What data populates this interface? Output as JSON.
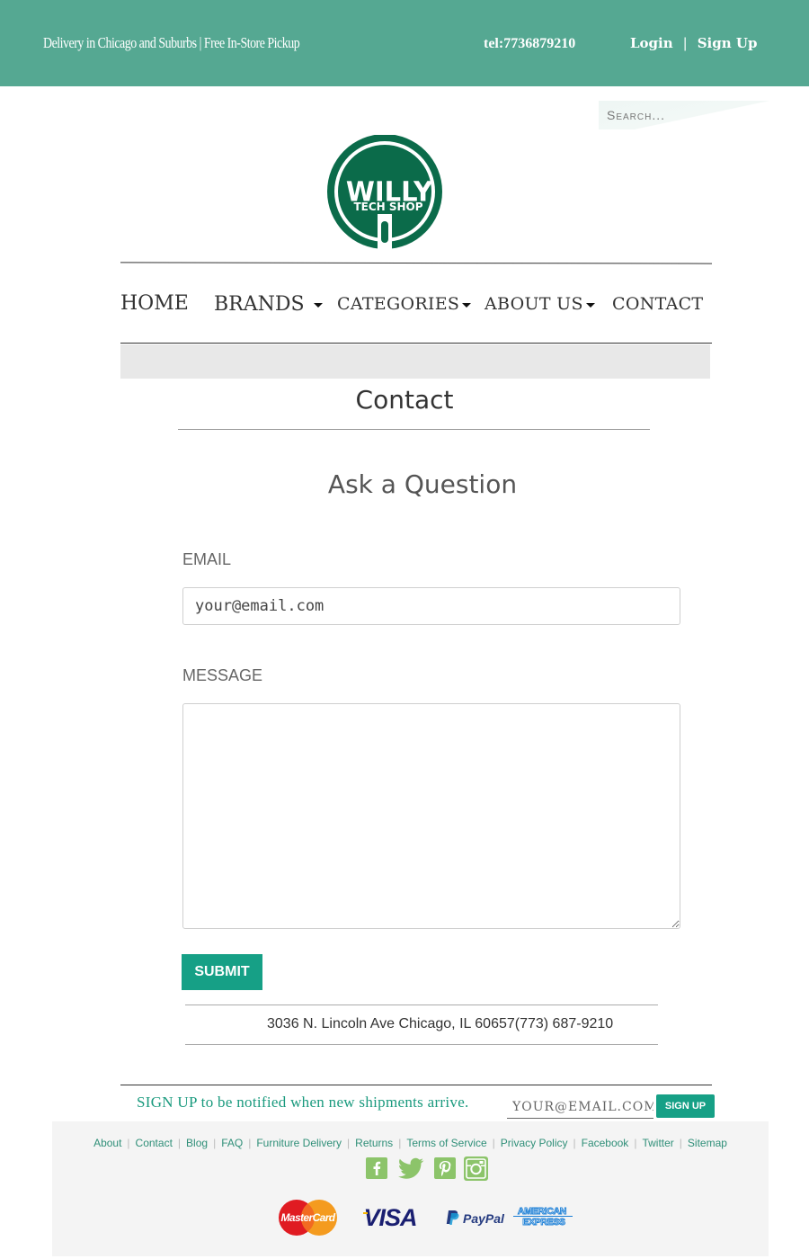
{
  "topbar": {
    "promo": "Delivery in Chicago and Suburbs | Free In-Store Pickup",
    "tel": "tel:7736879210",
    "login": "Login",
    "separator": "|",
    "signup": "Sign Up"
  },
  "search": {
    "placeholder": "Search..."
  },
  "logo": {
    "line1": "WILLY",
    "line2": "TECH SHOP",
    "color": "#0b6b4a"
  },
  "nav": {
    "items": [
      {
        "label": "HOME",
        "dropdown": false
      },
      {
        "label": "BRANDS",
        "dropdown": true
      },
      {
        "label": "CATEGORIES",
        "dropdown": true
      },
      {
        "label": "ABOUT US",
        "dropdown": true
      },
      {
        "label": "CONTACT",
        "dropdown": false
      }
    ]
  },
  "page": {
    "title": "Contact",
    "form_title": "Ask a Question",
    "email_label": "EMAIL",
    "email_placeholder": "your@email.com",
    "message_label": "MESSAGE",
    "message_value": "",
    "submit_label": "SUBMIT",
    "address": "3036 N. Lincoln Ave Chicago, IL 60657(773) 687-9210"
  },
  "newsletter": {
    "text_strong": "SIGN UP",
    "text_rest": " to be notified when new shipments arrive.",
    "email_placeholder": "YOUR@EMAIL.COM",
    "button_label": "SIGN UP"
  },
  "footer": {
    "links": [
      "About",
      "Contact",
      "Blog",
      "FAQ",
      "Furniture Delivery",
      "Returns",
      "Terms of Service",
      "Privacy Policy",
      "Facebook",
      "Twitter",
      "Sitemap"
    ],
    "social_icons": [
      "facebook-icon",
      "twitter-icon",
      "pinterest-icon",
      "instagram-icon"
    ],
    "payment_icons": [
      "mastercard-icon",
      "visa-icon",
      "paypal-icon",
      "american-express-icon"
    ],
    "payment_text": {
      "mastercard": "MasterCard",
      "visa": "VISA",
      "paypal": "PayPal",
      "amex_line1": "AMERICAN",
      "amex_line2": "EXPRESS"
    }
  },
  "colors": {
    "topbar": "#55a892",
    "accent": "#16a086",
    "link": "#2f8f78",
    "social": "#8cc46a"
  }
}
